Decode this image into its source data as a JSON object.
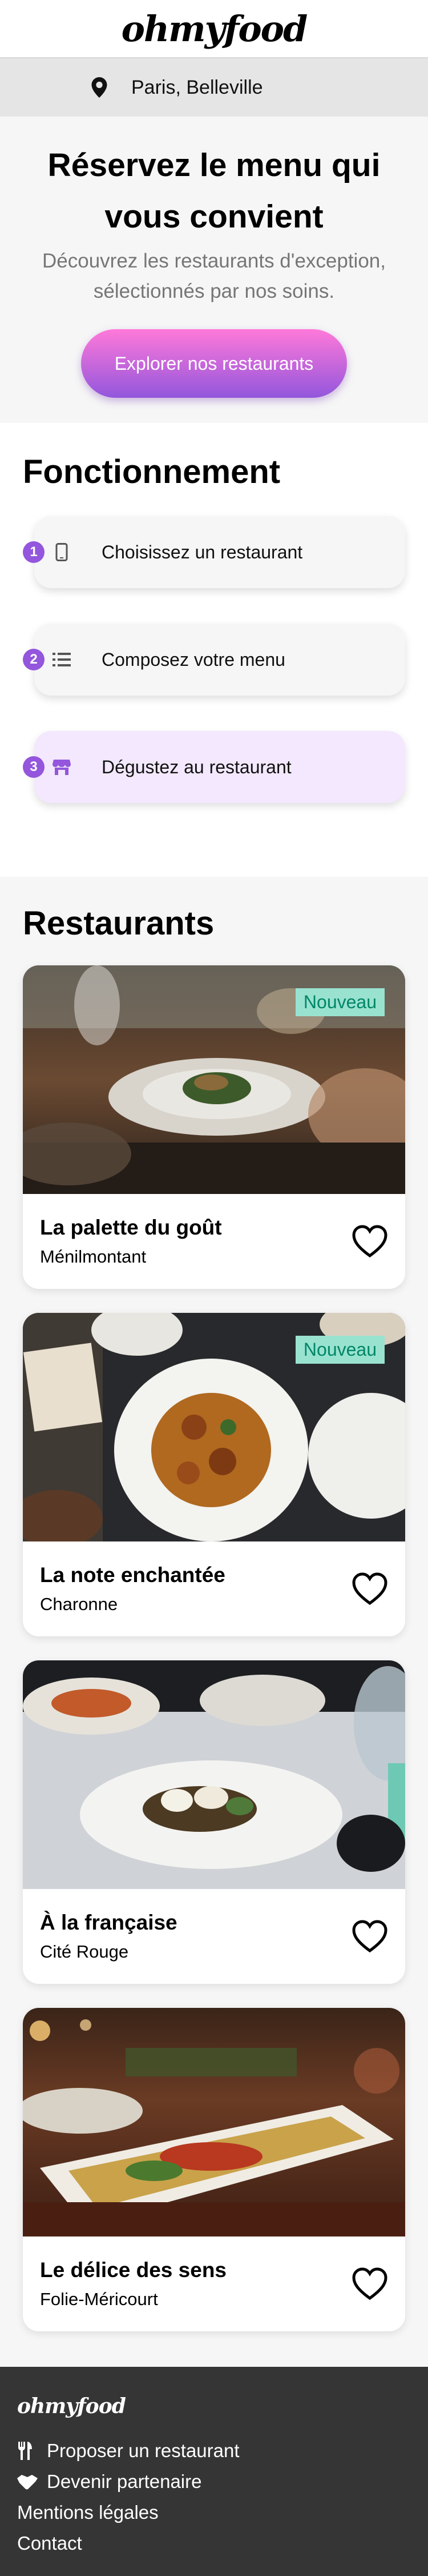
{
  "header": {
    "logo": "ohmyfood",
    "location": "Paris, Belleville"
  },
  "hero": {
    "title": "Réservez le menu qui vous convient",
    "subtitle": "Découvrez les restaurants d'exception, sélectionnés par nos soins.",
    "cta": "Explorer nos restaurants"
  },
  "how": {
    "title": "Fonctionnement",
    "steps": [
      {
        "num": "1",
        "label": "Choisissez un restaurant",
        "icon": "phone-icon"
      },
      {
        "num": "2",
        "label": "Composez votre menu",
        "icon": "list-icon"
      },
      {
        "num": "3",
        "label": "Dégustez au restaurant",
        "icon": "store-icon"
      }
    ]
  },
  "restaurants": {
    "title": "Restaurants",
    "items": [
      {
        "name": "La palette du goût",
        "area": "Ménilmontant",
        "badge": "Nouveau"
      },
      {
        "name": "La note enchantée",
        "area": "Charonne",
        "badge": "Nouveau"
      },
      {
        "name": "À la française",
        "area": "Cité Rouge",
        "badge": ""
      },
      {
        "name": "Le délice des sens",
        "area": "Folie-Méricourt",
        "badge": ""
      }
    ]
  },
  "footer": {
    "logo": "ohmyfood",
    "links": [
      "Proposer un restaurant",
      "Devenir partenaire",
      "Mentions légales",
      "Contact"
    ]
  },
  "colors": {
    "accent": "#9356dc",
    "accent_light": "#ff79da",
    "badge_bg": "#99e2d0",
    "badge_text": "#008766",
    "footer_bg": "#353535"
  }
}
